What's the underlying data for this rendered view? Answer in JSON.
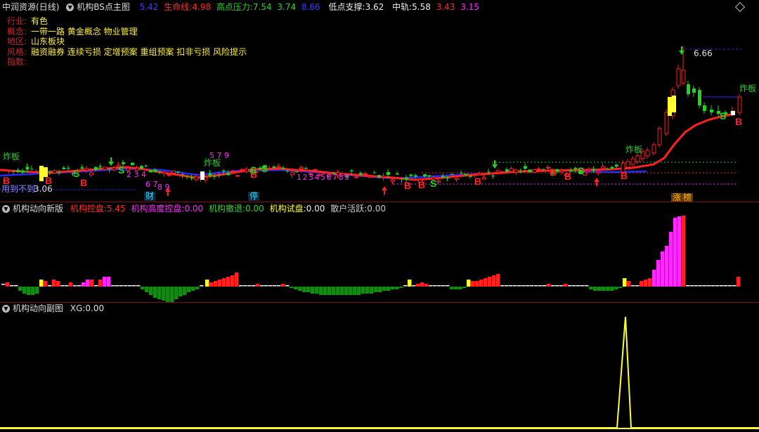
{
  "colors": {
    "green": "#1fd51f",
    "red": "#ff2020",
    "blue": "#2828ff",
    "yellow": "#ffff30",
    "magenta": "#ff28ff",
    "cyan": "#23d8ff",
    "white": "#ffffff",
    "darkgreen": "#138a13",
    "orange": "#ffb000"
  },
  "main": {
    "stock_name": "中润资源",
    "period": "(日线)",
    "indicator": "机构BS点主图",
    "v0": "5.42",
    "life_label": "生命线:",
    "life_val": "4.98",
    "hp_label": "高点压力:",
    "hp_val1": "7.54",
    "hp_val2": "3.74",
    "hp_val3": "8.66",
    "lp_label": "低点支撑:",
    "lp_val": "3.62",
    "mid_label": "中轨:",
    "mid_val1": "5.58",
    "mid_val2": "3.43",
    "mid_val3": "3.15",
    "diamond_icon": "diamond-icon"
  },
  "info": [
    {
      "k": "行业:",
      "v": "有色"
    },
    {
      "k": "概念:",
      "v": "一带一路 黄金概念 物业管理"
    },
    {
      "k": "地区:",
      "v": "山东板块"
    },
    {
      "k": "风格:",
      "v": "融资融券 连续亏损 定增预案 重组预案 扣非亏损 风险提示"
    },
    {
      "k": "指数:",
      "v": ""
    }
  ],
  "chart_labels": {
    "peak_price": "6.66",
    "low_price": "3.06",
    "cost_label": "用到不到",
    "zhaban1": "炸板",
    "zhaban2": "炸板",
    "zhaban3": "炸板",
    "zhaban4": "炸板",
    "cai": "财",
    "ting": "停",
    "zhang": "涨",
    "bang": "榜",
    "B": "B",
    "S": "S",
    "nums_a": "2 3 4",
    "nums_b": "6 7",
    "nums_c": "8 9",
    "nums_d": "5 7 9",
    "nums_e": "1 2 3 4 5 6 7 8 9"
  },
  "sub1": {
    "title": "机构动向新版",
    "l1": "机构控盘:",
    "v1": "5.45",
    "l2": "机构高度控盘:",
    "v2": "0.00",
    "l3": "机构撤退:",
    "v3": "0.00",
    "l4": "机构试盘:",
    "v4": "0.00",
    "l5": "散户活跃:",
    "v5": "0.00"
  },
  "sub2": {
    "title": "机构动向副图",
    "l1": "XG:",
    "v1": "0.00"
  }
}
